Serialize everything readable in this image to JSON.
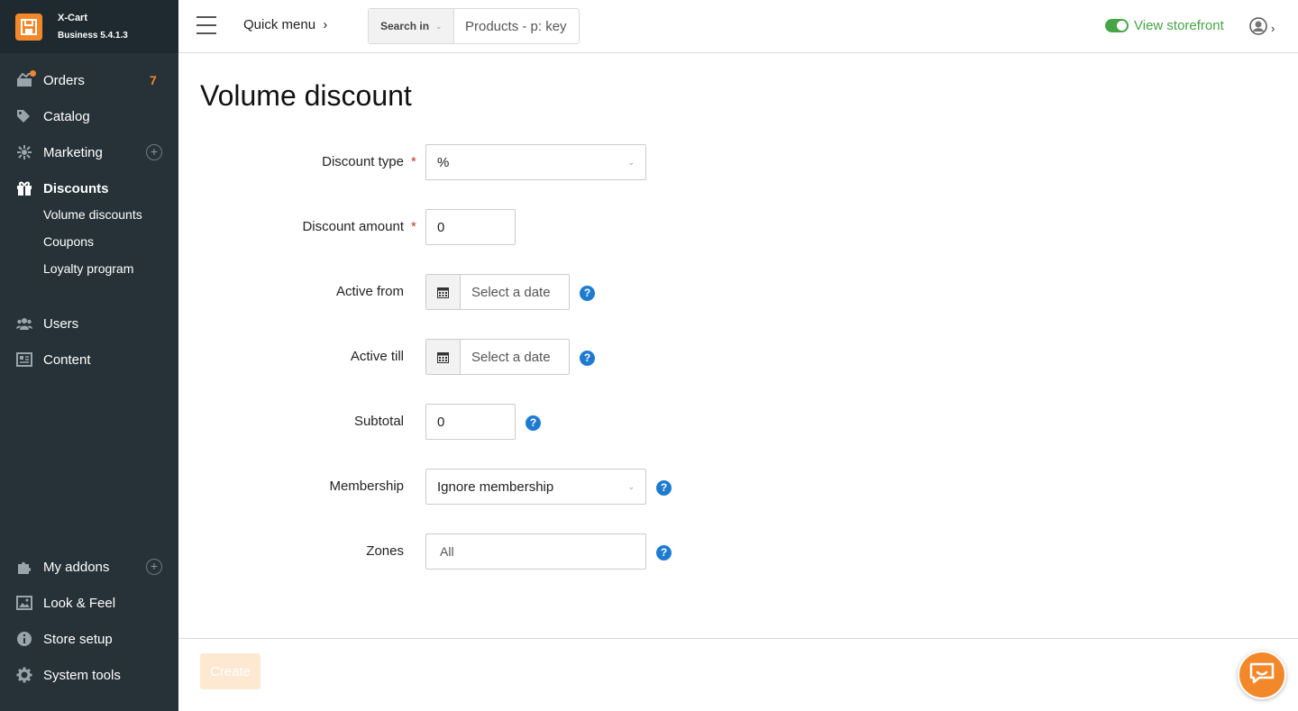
{
  "brand": {
    "name": "X-Cart",
    "version": "Business 5.4.1.3"
  },
  "sidebar": {
    "items": [
      {
        "label": "Orders",
        "badge": "7",
        "icon": "orders-icon"
      },
      {
        "label": "Catalog",
        "icon": "tag-icon"
      },
      {
        "label": "Marketing",
        "icon": "marketing-icon"
      },
      {
        "label": "Discounts",
        "icon": "gift-icon"
      },
      {
        "label": "Users",
        "icon": "users-icon"
      },
      {
        "label": "Content",
        "icon": "content-icon"
      },
      {
        "label": "My addons",
        "icon": "puzzle-icon"
      },
      {
        "label": "Look & Feel",
        "icon": "image-icon"
      },
      {
        "label": "Store setup",
        "icon": "info-icon"
      },
      {
        "label": "System tools",
        "icon": "gear-icon"
      }
    ],
    "discount_subitems": [
      "Volume discounts",
      "Coupons",
      "Loyalty program"
    ]
  },
  "topbar": {
    "quick_menu": "Quick menu",
    "search_scope": "Search in",
    "search_placeholder": "Products - p: key",
    "storefront_label": "View storefront"
  },
  "page": {
    "title": "Volume discount"
  },
  "form": {
    "discount_type": {
      "label": "Discount type",
      "value": "%"
    },
    "discount_amount": {
      "label": "Discount amount",
      "value": "0"
    },
    "active_from": {
      "label": "Active from",
      "placeholder": "Select a date"
    },
    "active_till": {
      "label": "Active till",
      "placeholder": "Select a date"
    },
    "subtotal": {
      "label": "Subtotal",
      "value": "0"
    },
    "membership": {
      "label": "Membership",
      "value": "Ignore membership"
    },
    "zones": {
      "label": "Zones",
      "value": "All"
    },
    "required_mark": "*",
    "help_mark": "?"
  },
  "footer": {
    "create_label": "Create"
  },
  "colors": {
    "sidebar": "#273238",
    "accent": "#f3882a",
    "storefront": "#47a447",
    "help": "#1e7bd0"
  }
}
